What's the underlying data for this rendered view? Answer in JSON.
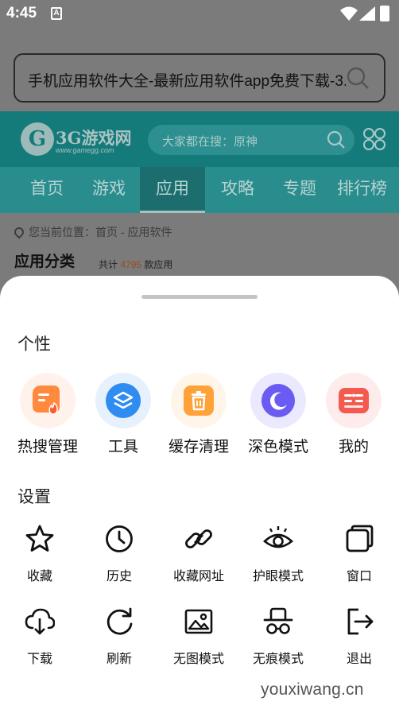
{
  "status_bar": {
    "time": "4:45",
    "a_badge": "A"
  },
  "url_bar": {
    "text": "手机应用软件大全-最新应用软件app免费下载-3..."
  },
  "site": {
    "logo_glyph": "G",
    "logo_text": "3G游戏网",
    "logo_sub": "www.gamegg.com",
    "search_placeholder": "大家都在搜：原神",
    "nav": [
      "首页",
      "游戏",
      "应用",
      "攻略",
      "专题",
      "排行榜"
    ],
    "nav_active": "应用",
    "breadcrumb": "您当前位置：首页 - 应用软件",
    "category_title": "应用分类",
    "count_prefix": "共计",
    "count_value": "4795",
    "count_suffix": "款应用"
  },
  "sheet": {
    "personal_title": "个性",
    "features": [
      {
        "label": "热搜管理",
        "icon": "hot-search-icon",
        "bg": "#fff2ec",
        "color": "#ff8a3d"
      },
      {
        "label": "工具",
        "icon": "tools-icon",
        "bg": "#e6f1fd",
        "color": "#2f8cf0"
      },
      {
        "label": "缓存清理",
        "icon": "trash-icon",
        "bg": "#fff5e8",
        "color": "#ffa23a"
      },
      {
        "label": "深色模式",
        "icon": "moon-icon",
        "bg": "#ebe9fd",
        "color": "#6a5cf2"
      },
      {
        "label": "我的",
        "icon": "profile-icon",
        "bg": "#fdeceb",
        "color": "#f55a4e"
      }
    ],
    "settings_title": "设置",
    "tools_row1": [
      {
        "label": "收藏",
        "icon": "star-icon"
      },
      {
        "label": "历史",
        "icon": "clock-icon"
      },
      {
        "label": "收藏网址",
        "icon": "link-icon"
      },
      {
        "label": "护眼模式",
        "icon": "eye-icon"
      },
      {
        "label": "窗口",
        "icon": "window-icon"
      }
    ],
    "tools_row2": [
      {
        "label": "下载",
        "icon": "cloud-download-icon"
      },
      {
        "label": "刷新",
        "icon": "refresh-icon"
      },
      {
        "label": "无图模式",
        "icon": "no-image-icon"
      },
      {
        "label": "无痕模式",
        "icon": "incognito-icon"
      },
      {
        "label": "退出",
        "icon": "exit-icon"
      }
    ]
  },
  "watermark": "youxiwang.cn"
}
